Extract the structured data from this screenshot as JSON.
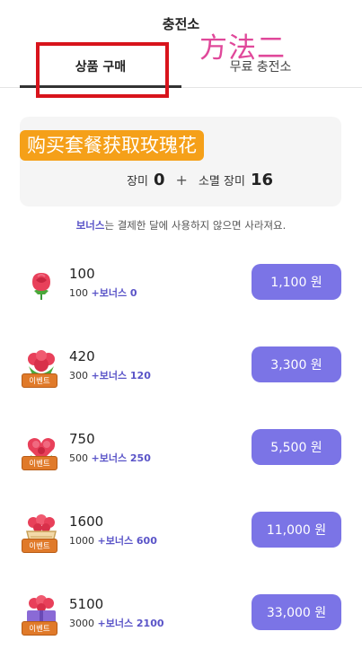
{
  "header": {
    "title": "충전소",
    "overlay_text": "方法二",
    "tabs": [
      {
        "label": "상품 구매",
        "active": true
      },
      {
        "label": "무료 충전소",
        "active": false
      }
    ]
  },
  "balance_card": {
    "promo_text": "购买套餐获取玫瑰花",
    "rose_label": "장미",
    "rose_value": "0",
    "plus": "+",
    "consumable_label": "소멸 장미",
    "consumable_value": "16"
  },
  "notice": {
    "highlight": "보너스",
    "rest": "는 결제한 달에 사용하지 않으면 사라져요."
  },
  "products": [
    {
      "amount": "100",
      "base": "100",
      "bonus_label": "+보너스 0",
      "price": "1,100 원",
      "event": ""
    },
    {
      "amount": "420",
      "base": "300",
      "bonus_label": "+보너스 120",
      "price": "3,300 원",
      "event": "이벤트"
    },
    {
      "amount": "750",
      "base": "500",
      "bonus_label": "+보너스 250",
      "price": "5,500 원",
      "event": "이벤트"
    },
    {
      "amount": "1600",
      "base": "1000",
      "bonus_label": "+보너스 600",
      "price": "11,000 원",
      "event": "이벤트"
    },
    {
      "amount": "5100",
      "base": "3000",
      "bonus_label": "+보너스 2100",
      "price": "33,000 원",
      "event": "이벤트"
    }
  ],
  "colors": {
    "accent": "#7b74e6",
    "bonus_text": "#5a54c8",
    "promo_bg": "#f5a019",
    "event_tag": "#e07a2a",
    "highlight_box": "#d8141c"
  },
  "icons": [
    "single-rose-icon",
    "rose-bouquet-icon",
    "rose-heart-icon",
    "rose-basket-icon",
    "rose-gift-box-icon"
  ]
}
